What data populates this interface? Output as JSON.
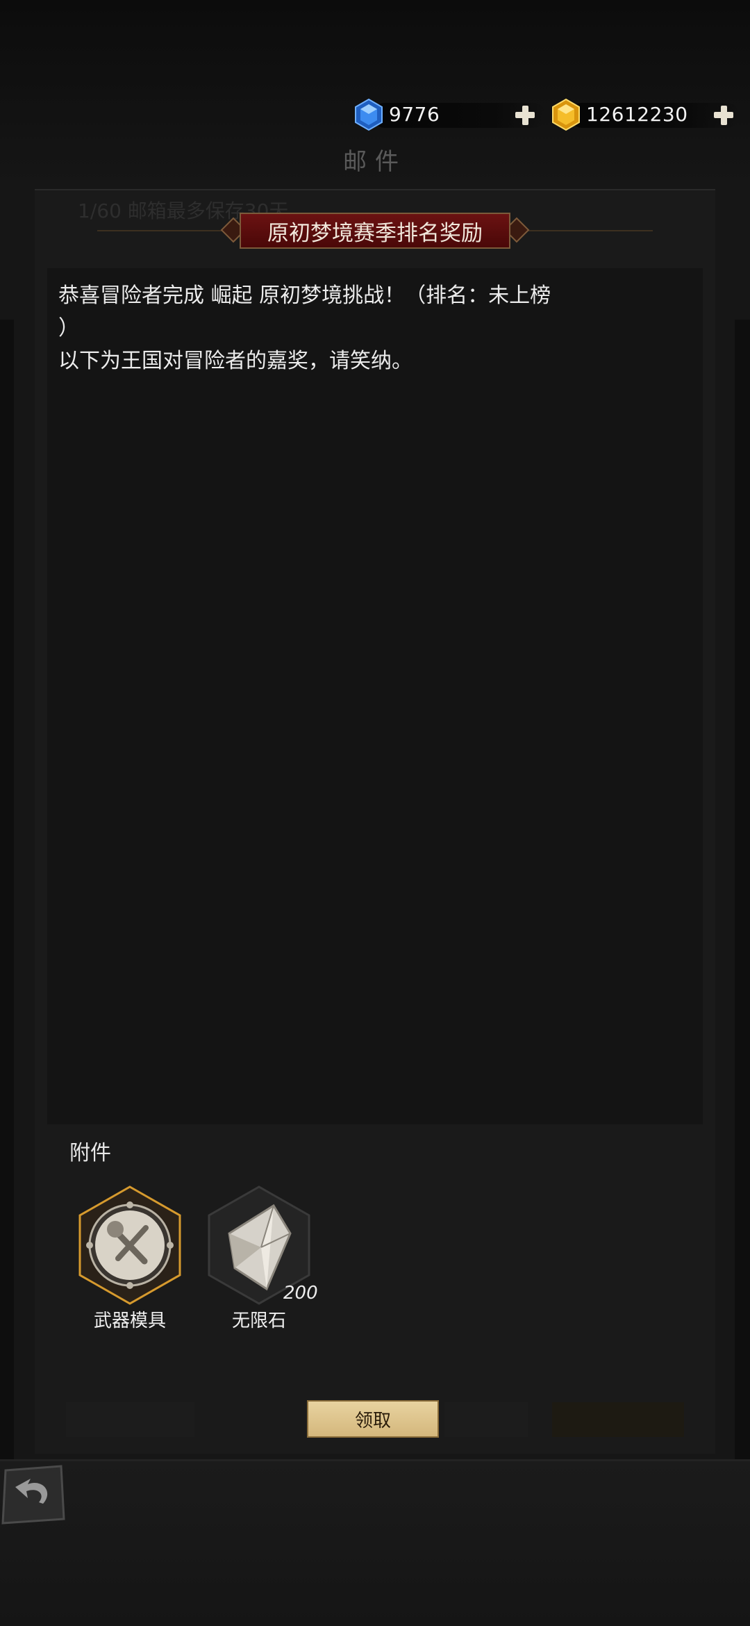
{
  "currencies": [
    {
      "name": "blue-gem",
      "value": "9776",
      "color": "#2a7ad6"
    },
    {
      "name": "gold-gem",
      "value": "12612230",
      "color": "#f0b41e"
    }
  ],
  "page_title": "邮件",
  "background_hint": "1/60 邮箱最多保存30天",
  "dialog": {
    "title": "原初梦境赛季排名奖励",
    "message_lines": [
      "恭喜冒险者完成 崛起 原初梦境挑战！（排名：未上榜",
      "）",
      "以下为王国对冒险者的嘉奖，请笑纳。"
    ],
    "attachments_label": "附件",
    "attachments": [
      {
        "name": "武器模具",
        "icon": "weapon-mold-icon",
        "count": ""
      },
      {
        "name": "无限石",
        "icon": "infinity-stone-icon",
        "count": "200"
      }
    ],
    "claim_label": "领取"
  },
  "colors": {
    "banner": "#6b1212",
    "accent_gold": "#d4a24a",
    "button": "#e0c68e"
  }
}
